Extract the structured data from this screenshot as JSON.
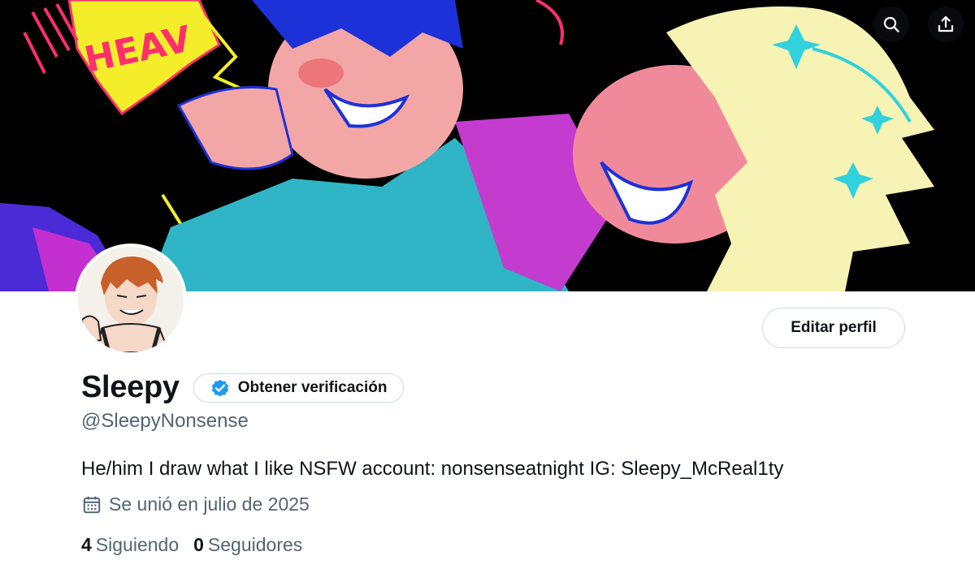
{
  "header": {
    "search_icon": "search-icon",
    "share_icon": "share-upload-icon"
  },
  "profile": {
    "display_name": "Sleepy",
    "handle": "@SleepyNonsense",
    "bio": "He/him I draw what I like NSFW account: nonsenseatnight IG: Sleepy_McReal1ty",
    "joined": "Se unió en julio de 2025",
    "edit_button": "Editar perfil",
    "verify_button": "Obtener verificación",
    "banner_text": "HEAV"
  },
  "stats": [
    {
      "count": "4",
      "label": "Siguiendo"
    },
    {
      "count": "0",
      "label": "Seguidores"
    }
  ],
  "colors": {
    "accent_blue": "#1d9bf0",
    "secondary_text": "#536471",
    "border": "#cfd9de"
  }
}
